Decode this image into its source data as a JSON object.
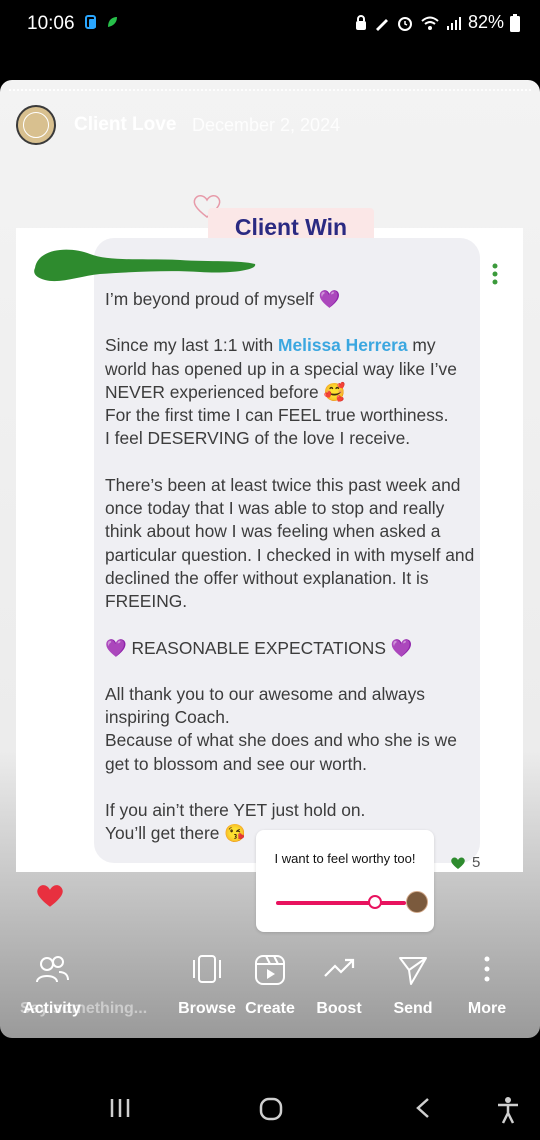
{
  "status_bar": {
    "time": "10:06",
    "battery": "82%"
  },
  "story": {
    "author": "Client Love",
    "date": "December 2, 2024",
    "badge": "Client Win"
  },
  "message": {
    "lines": [
      "I’m beyond proud of myself 💜",
      "",
      "Since my last 1:1 with ",
      "Melissa Herrera",
      " my world has opened up in a special way like I’ve NEVER experienced before 🥰",
      "For the first time I can FEEL true worthiness.",
      "I feel DESERVING of the love I receive.",
      "",
      "There’s been at least twice this past week and once today that I was able to stop and really think about how I was feeling when asked a particular question. I checked in with myself and declined the offer without explanation. It is FREEING.",
      "",
      "💜 REASONABLE EXPECTATIONS 💜",
      "",
      "All thank you to our awesome and always inspiring Coach.",
      "Because of what she does and who she is we get to blossom and see our worth.",
      "",
      "If you ain’t there YET just hold on.",
      "You’ll get there 😘"
    ],
    "likes": "5"
  },
  "poll": {
    "question": "I want to feel worthy too!",
    "value_percent": 76
  },
  "actions": {
    "ghost_text": "Say something...",
    "activity": "Activity",
    "browse": "Browse",
    "create": "Create",
    "boost": "Boost",
    "send": "Send",
    "more": "More"
  },
  "colors": {
    "brand_navy": "#2b2a82",
    "mention_blue": "#3ba7e0",
    "poll_pink": "#e8125e",
    "like_red": "#e8303f"
  }
}
